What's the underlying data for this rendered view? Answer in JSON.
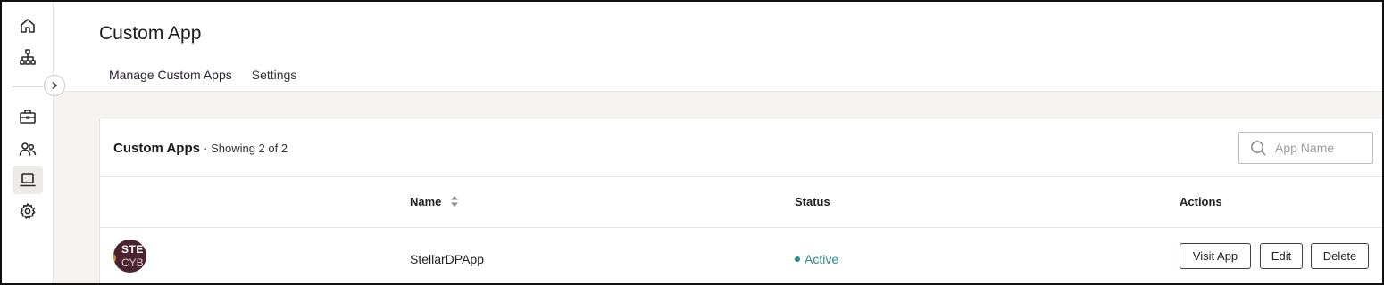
{
  "sidebar": {
    "items": [
      {
        "icon": "home-icon"
      },
      {
        "icon": "sitemap-icon"
      },
      {
        "icon": "briefcase-icon"
      },
      {
        "icon": "users-icon"
      },
      {
        "icon": "laptop-icon"
      },
      {
        "icon": "gear-icon"
      }
    ],
    "active_icon": "laptop-icon"
  },
  "header": {
    "title": "Custom App",
    "tabs": [
      {
        "label": "Manage Custom Apps",
        "active": true
      },
      {
        "label": "Settings",
        "active": false
      }
    ]
  },
  "card": {
    "title": "Custom Apps",
    "subtitle": "· Showing 2 of 2",
    "search": {
      "placeholder": "App Name",
      "value": ""
    }
  },
  "table": {
    "columns": [
      "Name",
      "Status",
      "Actions"
    ],
    "rows": [
      {
        "avatar_text_1": "STE",
        "avatar_text_2": "CYB",
        "name": "StellarDPApp",
        "status": "Active",
        "actions": [
          "Visit App",
          "Edit",
          "Delete"
        ]
      }
    ]
  },
  "colors": {
    "accent": "#2b2035",
    "status_active": "#2c8c87",
    "content_bg": "#f4f3f0"
  }
}
